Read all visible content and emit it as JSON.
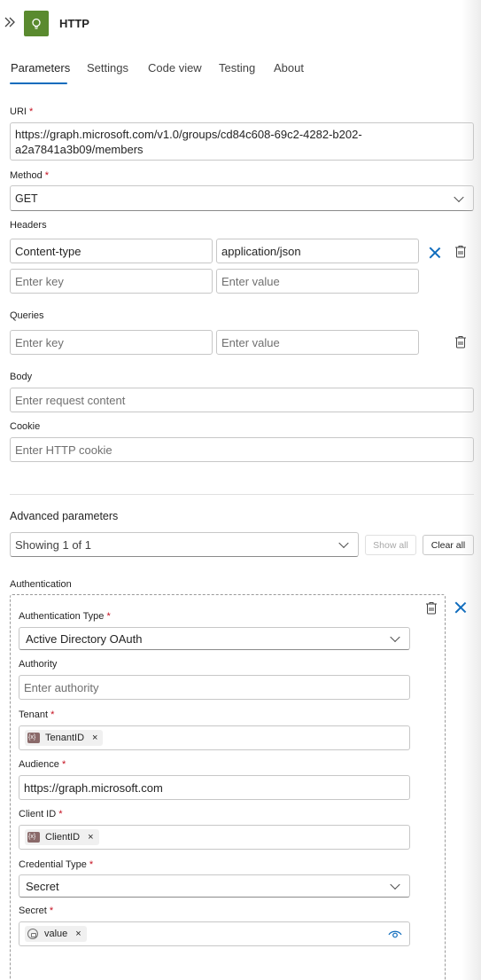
{
  "header": {
    "title": "HTTP",
    "expand_icon": "double-chevron-right-icon",
    "app_icon": "lightbulb-icon",
    "accent": "#5a8a2f"
  },
  "tabs": [
    "Parameters",
    "Settings",
    "Code view",
    "Testing",
    "About"
  ],
  "active_tab": "Parameters",
  "required_marker": "*",
  "uri": {
    "label": "URI",
    "value_line1": "https://graph.microsoft.com/v1.0/groups/cd84c608-69c2-4282-b202-",
    "value_line2": "a2a7841a3b09/members"
  },
  "method": {
    "label": "Method",
    "value": "GET"
  },
  "headers": {
    "label": "Headers",
    "rows": [
      {
        "key": "Content-type",
        "value": "application/json"
      }
    ],
    "key_placeholder": "Enter key",
    "value_placeholder": "Enter value"
  },
  "queries": {
    "label": "Queries",
    "key_placeholder": "Enter key",
    "value_placeholder": "Enter value"
  },
  "body": {
    "label": "Body",
    "placeholder": "Enter request content"
  },
  "cookie": {
    "label": "Cookie",
    "placeholder": "Enter HTTP cookie"
  },
  "advanced": {
    "label": "Advanced parameters",
    "value": "Showing 1 of 1",
    "show_all": "Show all",
    "clear_all": "Clear all"
  },
  "authentication": {
    "label": "Authentication",
    "type": {
      "label": "Authentication Type",
      "value": "Active Directory OAuth"
    },
    "authority": {
      "label": "Authority",
      "placeholder": "Enter authority"
    },
    "tenant": {
      "label": "Tenant",
      "token": "TenantID"
    },
    "audience": {
      "label": "Audience",
      "value": "https://graph.microsoft.com"
    },
    "client_id": {
      "label": "Client ID",
      "token": "ClientID"
    },
    "credential_type": {
      "label": "Credential Type",
      "value": "Secret"
    },
    "secret": {
      "label": "Secret",
      "token": "value"
    }
  },
  "token_close": "×"
}
